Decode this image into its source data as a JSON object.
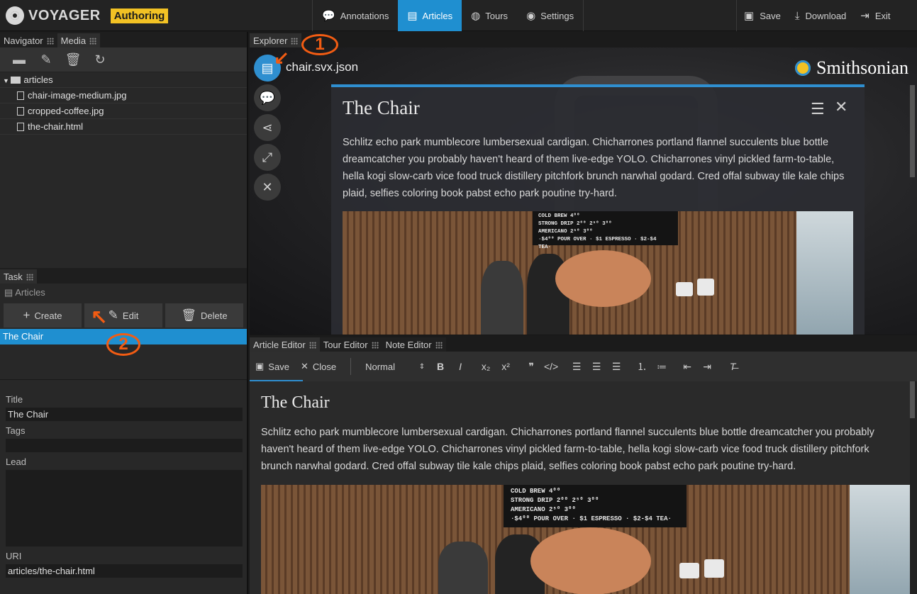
{
  "brand": {
    "name": "VOYAGER",
    "mode": "Authoring"
  },
  "nav_tabs": [
    {
      "label": "Annotations",
      "icon": "comment-icon"
    },
    {
      "label": "Articles",
      "icon": "file-icon",
      "active": true
    },
    {
      "label": "Tours",
      "icon": "globe-icon"
    },
    {
      "label": "Settings",
      "icon": "eye-icon"
    }
  ],
  "top_actions": {
    "save": "Save",
    "download": "Download",
    "exit": "Exit"
  },
  "left_tabs": {
    "navigator": "Navigator",
    "media": "Media"
  },
  "media_tree": {
    "folder": "articles",
    "files": [
      "chair-image-medium.jpg",
      "cropped-coffee.jpg",
      "the-chair.html"
    ]
  },
  "task": {
    "tab": "Task",
    "header": "Articles",
    "buttons": {
      "create": "Create",
      "edit": "Edit",
      "delete": "Delete"
    },
    "articles": [
      "The Chair"
    ]
  },
  "properties": {
    "title_label": "Title",
    "title_value": "The Chair",
    "tags_label": "Tags",
    "tags_value": "",
    "lead_label": "Lead",
    "lead_value": "",
    "uri_label": "URI",
    "uri_value": "articles/the-chair.html"
  },
  "explorer": {
    "tab": "Explorer",
    "file_title": "chair.svx.json",
    "logo_text": "Smithsonian",
    "article_title": "The Chair",
    "article_body": "Schlitz echo park mumblecore lumbersexual cardigan. Chicharrones portland flannel succulents blue bottle dreamcatcher you probably haven't heard of them live-edge YOLO. Chicharrones vinyl pickled farm-to-table, hella kogi slow-carb vice food truck distillery pitchfork brunch narwhal godard. Cred offal subway tile kale chips plaid, selfies coloring book pabst echo park poutine try-hard."
  },
  "menu_board": {
    "rows": [
      {
        "item": "COLD BREW",
        "prices": [
          "",
          "",
          "4⁰⁰"
        ]
      },
      {
        "item": "STRONG DRIP",
        "prices": [
          "2⁰⁰",
          "2⁵⁰",
          "3⁰⁰"
        ]
      },
      {
        "item": "AMERICANO",
        "prices": [
          "2⁵⁰",
          "",
          "3⁰⁰"
        ]
      }
    ],
    "footer": "·$4⁰⁰ POUR OVER · $1 ESPRESSO · $2-$4 TEA·"
  },
  "annotations": {
    "one": "1",
    "two": "2"
  },
  "editor_tabs": {
    "article": "Article Editor",
    "tour": "Tour Editor",
    "note": "Note Editor"
  },
  "editor_toolbar": {
    "save": "Save",
    "close": "Close",
    "format": "Normal"
  },
  "editor_doc": {
    "title": "The Chair",
    "body": "Schlitz echo park mumblecore lumbersexual cardigan. Chicharrones portland flannel succulents blue bottle dreamcatcher you probably haven't heard of them live-edge YOLO. Chicharrones vinyl pickled farm-to-table, hella kogi slow-carb vice food truck distillery pitchfork brunch narwhal godard. Cred offal subway tile kale chips plaid, selfies coloring book pabst echo park poutine try-hard."
  },
  "colors": {
    "accent": "#1f8fd0",
    "badge": "#f2c224",
    "annotation": "#f25c13"
  }
}
